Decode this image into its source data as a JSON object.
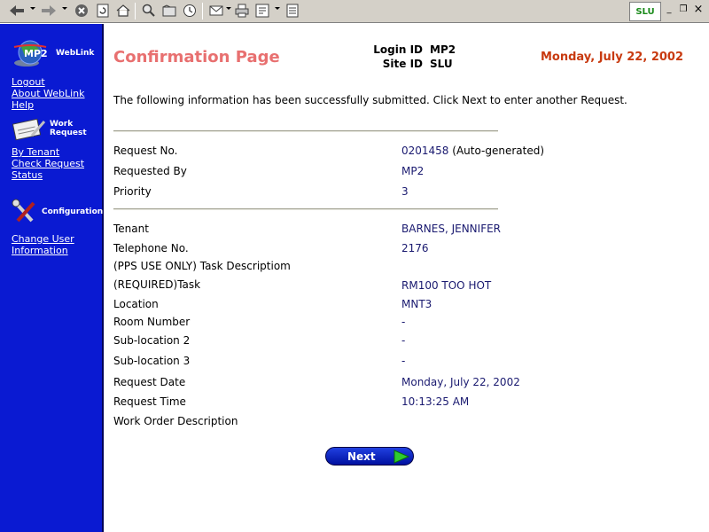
{
  "browser": {
    "brand": "SLU",
    "window_minimize": "_",
    "window_restore": "❐",
    "window_close": "×"
  },
  "sidebar": {
    "logo_text": "MP2",
    "weblink_label": "WebLink",
    "links_top": [
      "Logout",
      "About WebLink",
      "Help"
    ],
    "work_request_label": "Work Request",
    "links_work": [
      "By Tenant",
      "Check Request Status"
    ],
    "configuration_label": "Configuration",
    "links_config": [
      "Change User Information"
    ]
  },
  "header": {
    "title": "Confirmation Page",
    "login_id_label": "Login ID",
    "login_id": "MP2",
    "site_id_label": "Site ID",
    "site_id": "SLU",
    "date": "Monday, July 22, 2002"
  },
  "intro": "The following information has been successfully submitted. Click Next to enter another Request.",
  "request": {
    "request_no_label": "Request No.",
    "request_no": "0201458",
    "request_no_note": "(Auto-generated)",
    "requested_by_label": "Requested By",
    "requested_by": "MP2",
    "priority_label": "Priority",
    "priority": "3"
  },
  "details": {
    "tenant_label": "Tenant",
    "tenant": "BARNES, JENNIFER",
    "telephone_label": "Telephone No.",
    "telephone": "2176",
    "pps_label": "(PPS USE ONLY) Task Descriptiom",
    "task_label": "(REQUIRED)Task",
    "task": "RM100 TOO HOT",
    "location_label": "Location",
    "location": "MNT3",
    "room_label": "Room Number",
    "room": "-",
    "subloc2_label": "Sub-location 2",
    "subloc2": "-",
    "subloc3_label": "Sub-location 3",
    "subloc3": "-",
    "request_date_label": "Request Date",
    "request_date": "Monday, July 22, 2002",
    "request_time_label": "Request Time",
    "request_time": "10:13:25 AM",
    "wo_desc_label": "Work Order Description"
  },
  "next_button": "Next",
  "colors": {
    "sidebar_blue": "#0a1ad2",
    "title_pink": "#e87070",
    "date_red": "#c83a10",
    "value_navy": "#1a1a70",
    "arrow_green": "#2ecc2e"
  }
}
